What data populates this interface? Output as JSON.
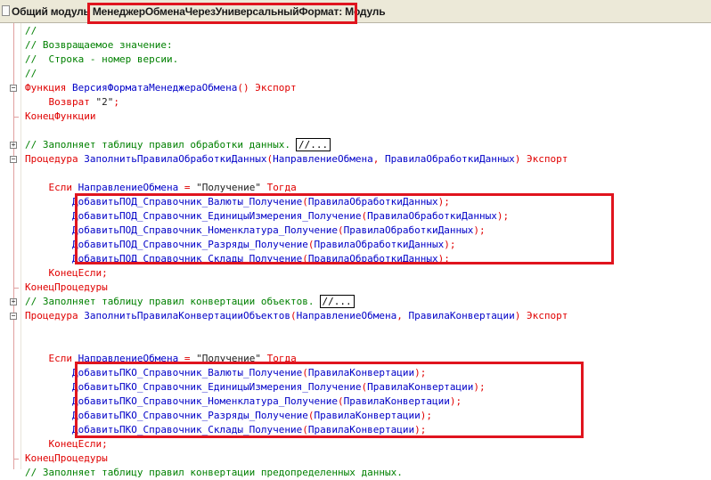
{
  "tab": {
    "prefix": "Общий модуль",
    "module_name": "МенеджерОбменаЧерезУниверсальныйФормат",
    "suffix": ": Модуль"
  },
  "code_lines": [
    {
      "indent": "",
      "parts": [
        {
          "t": "cm",
          "v": "//"
        }
      ]
    },
    {
      "indent": "",
      "parts": [
        {
          "t": "cm",
          "v": "// Возвращаемое значение:"
        }
      ]
    },
    {
      "indent": "",
      "parts": [
        {
          "t": "cm",
          "v": "//  Строка - номер версии."
        }
      ]
    },
    {
      "indent": "",
      "parts": [
        {
          "t": "cm",
          "v": "//"
        }
      ]
    },
    {
      "indent": "",
      "parts": [
        {
          "t": "kw",
          "v": "Функция "
        },
        {
          "t": "id",
          "v": "ВерсияФорматаМенеджераОбмена"
        },
        {
          "t": "sp",
          "v": "() "
        },
        {
          "t": "kw",
          "v": "Экспорт"
        }
      ]
    },
    {
      "indent": "    ",
      "parts": [
        {
          "t": "kw",
          "v": "Возврат "
        },
        {
          "t": "st",
          "v": "\"2\""
        },
        {
          "t": "sp",
          "v": ";"
        }
      ]
    },
    {
      "indent": "",
      "parts": [
        {
          "t": "kw",
          "v": "КонецФункции"
        }
      ]
    },
    {
      "indent": "",
      "parts": []
    },
    {
      "indent": "",
      "parts": [
        {
          "t": "cm",
          "v": "// Заполняет таблицу правил обработки данных."
        },
        {
          "t": "box",
          "v": "//..."
        }
      ]
    },
    {
      "indent": "",
      "parts": [
        {
          "t": "kw",
          "v": "Процедура "
        },
        {
          "t": "id",
          "v": "ЗаполнитьПравилаОбработкиДанных"
        },
        {
          "t": "sp",
          "v": "("
        },
        {
          "t": "id",
          "v": "НаправлениеОбмена"
        },
        {
          "t": "sp",
          "v": ", "
        },
        {
          "t": "id",
          "v": "ПравилаОбработкиДанных"
        },
        {
          "t": "sp",
          "v": ") "
        },
        {
          "t": "kw",
          "v": "Экспорт"
        }
      ]
    },
    {
      "indent": "",
      "parts": []
    },
    {
      "indent": "    ",
      "parts": [
        {
          "t": "kw",
          "v": "Если "
        },
        {
          "t": "id",
          "v": "НаправлениеОбмена "
        },
        {
          "t": "sp",
          "v": "= "
        },
        {
          "t": "st",
          "v": "\"Получение\" "
        },
        {
          "t": "kw",
          "v": "Тогда"
        }
      ]
    },
    {
      "indent": "        ",
      "parts": [
        {
          "t": "id",
          "v": "ДобавитьПОД_Справочник_Валюты_Получение"
        },
        {
          "t": "sp",
          "v": "("
        },
        {
          "t": "id",
          "v": "ПравилаОбработкиДанных"
        },
        {
          "t": "sp",
          "v": ");"
        }
      ]
    },
    {
      "indent": "        ",
      "parts": [
        {
          "t": "id",
          "v": "ДобавитьПОД_Справочник_ЕдиницыИзмерения_Получение"
        },
        {
          "t": "sp",
          "v": "("
        },
        {
          "t": "id",
          "v": "ПравилаОбработкиДанных"
        },
        {
          "t": "sp",
          "v": ");"
        }
      ]
    },
    {
      "indent": "        ",
      "parts": [
        {
          "t": "id",
          "v": "ДобавитьПОД_Справочник_Номенклатура_Получение"
        },
        {
          "t": "sp",
          "v": "("
        },
        {
          "t": "id",
          "v": "ПравилаОбработкиДанных"
        },
        {
          "t": "sp",
          "v": ");"
        }
      ]
    },
    {
      "indent": "        ",
      "parts": [
        {
          "t": "id",
          "v": "ДобавитьПОД_Справочник_Разряды_Получение"
        },
        {
          "t": "sp",
          "v": "("
        },
        {
          "t": "id",
          "v": "ПравилаОбработкиДанных"
        },
        {
          "t": "sp",
          "v": ");"
        }
      ]
    },
    {
      "indent": "        ",
      "parts": [
        {
          "t": "id",
          "v": "ДобавитьПОД_Справочник_Склады_Получение"
        },
        {
          "t": "sp",
          "v": "("
        },
        {
          "t": "id",
          "v": "ПравилаОбработкиДанных"
        },
        {
          "t": "sp",
          "v": ");"
        }
      ]
    },
    {
      "indent": "    ",
      "parts": [
        {
          "t": "kw",
          "v": "КонецЕсли"
        },
        {
          "t": "sp",
          "v": ";"
        }
      ]
    },
    {
      "indent": "",
      "parts": [
        {
          "t": "kw",
          "v": "КонецПроцедуры"
        }
      ]
    },
    {
      "indent": "",
      "parts": [
        {
          "t": "cm",
          "v": "// Заполняет таблицу правил конвертации объектов."
        },
        {
          "t": "box",
          "v": "//..."
        }
      ]
    },
    {
      "indent": "",
      "parts": [
        {
          "t": "kw",
          "v": "Процедура "
        },
        {
          "t": "id",
          "v": "ЗаполнитьПравилаКонвертацииОбъектов"
        },
        {
          "t": "sp",
          "v": "("
        },
        {
          "t": "id",
          "v": "НаправлениеОбмена"
        },
        {
          "t": "sp",
          "v": ", "
        },
        {
          "t": "id",
          "v": "ПравилаКонвертации"
        },
        {
          "t": "sp",
          "v": ") "
        },
        {
          "t": "kw",
          "v": "Экспорт"
        }
      ]
    },
    {
      "indent": "",
      "parts": []
    },
    {
      "indent": "",
      "parts": []
    },
    {
      "indent": "    ",
      "parts": [
        {
          "t": "kw",
          "v": "Если "
        },
        {
          "t": "id",
          "v": "НаправлениеОбмена "
        },
        {
          "t": "sp",
          "v": "= "
        },
        {
          "t": "st",
          "v": "\"Получение\" "
        },
        {
          "t": "kw",
          "v": "Тогда"
        }
      ]
    },
    {
      "indent": "        ",
      "parts": [
        {
          "t": "id",
          "v": "ДобавитьПКО_Справочник_Валюты_Получение"
        },
        {
          "t": "sp",
          "v": "("
        },
        {
          "t": "id",
          "v": "ПравилаКонвертации"
        },
        {
          "t": "sp",
          "v": ");"
        }
      ]
    },
    {
      "indent": "        ",
      "parts": [
        {
          "t": "id",
          "v": "ДобавитьПКО_Справочник_ЕдиницыИзмерения_Получение"
        },
        {
          "t": "sp",
          "v": "("
        },
        {
          "t": "id",
          "v": "ПравилаКонвертации"
        },
        {
          "t": "sp",
          "v": ");"
        }
      ]
    },
    {
      "indent": "        ",
      "parts": [
        {
          "t": "id",
          "v": "ДобавитьПКО_Справочник_Номенклатура_Получение"
        },
        {
          "t": "sp",
          "v": "("
        },
        {
          "t": "id",
          "v": "ПравилаКонвертации"
        },
        {
          "t": "sp",
          "v": ");"
        }
      ]
    },
    {
      "indent": "        ",
      "parts": [
        {
          "t": "id",
          "v": "ДобавитьПКО_Справочник_Разряды_Получение"
        },
        {
          "t": "sp",
          "v": "("
        },
        {
          "t": "id",
          "v": "ПравилаКонвертации"
        },
        {
          "t": "sp",
          "v": ");"
        }
      ]
    },
    {
      "indent": "        ",
      "parts": [
        {
          "t": "id",
          "v": "ДобавитьПКО_Справочник_Склады_Получение"
        },
        {
          "t": "sp",
          "v": "("
        },
        {
          "t": "id",
          "v": "ПравилаКонвертации"
        },
        {
          "t": "sp",
          "v": ");"
        }
      ]
    },
    {
      "indent": "    ",
      "parts": [
        {
          "t": "kw",
          "v": "КонецЕсли"
        },
        {
          "t": "sp",
          "v": ";"
        }
      ]
    },
    {
      "indent": "",
      "parts": [
        {
          "t": "kw",
          "v": "КонецПроцедуры"
        }
      ]
    },
    {
      "indent": "",
      "parts": [
        {
          "t": "cm",
          "v": "// Заполняет таблицу правил конвертации предопределенных данных."
        }
      ]
    }
  ],
  "fold_markers": [
    {
      "line": 4,
      "symbol": "−"
    },
    {
      "line": 8,
      "symbol": "+"
    },
    {
      "line": 9,
      "symbol": "−"
    },
    {
      "line": 19,
      "symbol": "+"
    },
    {
      "line": 20,
      "symbol": "−"
    }
  ],
  "colors": {
    "comment": "#008000",
    "keyword": "#e00000",
    "identifier": "#0000c8",
    "highlight": "#e0141e"
  }
}
